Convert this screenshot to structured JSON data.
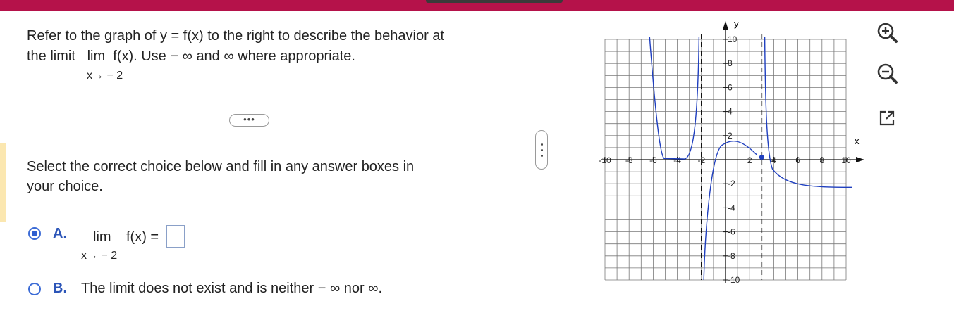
{
  "question": {
    "line1": "Refer to the graph of y = f(x) to the right to describe the behavior at",
    "line2_prefix": "the limit",
    "lim_word": "lim",
    "line2_func": "f(x). Use",
    "neg_inf": "− ∞",
    "and": "and",
    "pos_inf": "∞",
    "line2_suffix": "where appropriate.",
    "limit_sub": "x→ − 2"
  },
  "more_button": "•••",
  "instruction": {
    "line1": "Select the correct choice below and fill in any answer boxes in",
    "line2": "your choice."
  },
  "choices": [
    {
      "letter": "A.",
      "lim": "lim",
      "func": "f(x) =",
      "sub": "x→ − 2",
      "selected": true,
      "answer_value": ""
    },
    {
      "letter": "B.",
      "text": "The limit does not exist and is neither  − ∞ nor ∞.",
      "selected": false
    }
  ],
  "graph": {
    "x_axis_label": "x",
    "y_axis_label": "y",
    "x_tick_labels": [
      "-10",
      "-8",
      "-6",
      "-4",
      "-2",
      "2",
      "4",
      "6",
      "8",
      "10"
    ],
    "y_tick_labels": [
      "10",
      "8",
      "6",
      "4",
      "2",
      "-2",
      "-4",
      "-6",
      "-8",
      "-10"
    ],
    "curve_color": "#1f3fbf",
    "asymptotes_x": [
      -2,
      3
    ]
  },
  "tools": [
    "zoom-in-icon",
    "zoom-out-icon",
    "popout-icon"
  ],
  "colors": {
    "topbar": "#b5124a",
    "accent": "#2c55b8"
  }
}
